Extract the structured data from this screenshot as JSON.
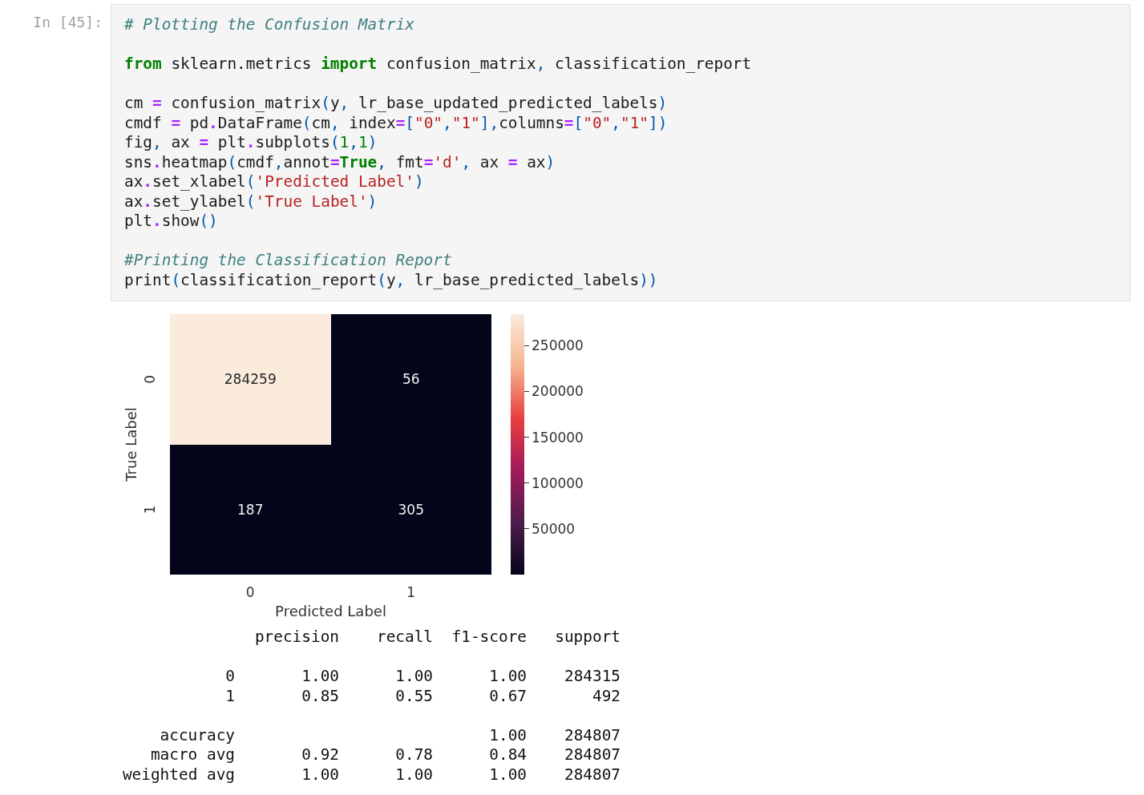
{
  "cell": {
    "prompt": "In [45]:",
    "code_blocks": [
      [
        [
          {
            "kind": "comment",
            "text": "# Plotting the Confusion Matrix"
          }
        ]
      ],
      [
        [
          {
            "kind": "keyword",
            "text": "from"
          },
          {
            "kind": "name",
            "text": " sklearn.metrics "
          },
          {
            "kind": "keyword",
            "text": "import"
          },
          {
            "kind": "name",
            "text": " confusion_matrix"
          },
          {
            "kind": "punct",
            "text": ","
          },
          {
            "kind": "name",
            "text": " classification_report"
          }
        ]
      ],
      [
        [
          {
            "kind": "name",
            "text": "cm "
          },
          {
            "kind": "operator",
            "text": "="
          },
          {
            "kind": "name",
            "text": " confusion_matrix"
          },
          {
            "kind": "punct",
            "text": "("
          },
          {
            "kind": "name",
            "text": "y"
          },
          {
            "kind": "punct",
            "text": ","
          },
          {
            "kind": "name",
            "text": " lr_base_updated_predicted_labels"
          },
          {
            "kind": "punct",
            "text": ")"
          }
        ],
        [
          {
            "kind": "name",
            "text": "cmdf "
          },
          {
            "kind": "operator",
            "text": "="
          },
          {
            "kind": "name",
            "text": " pd"
          },
          {
            "kind": "operator",
            "text": "."
          },
          {
            "kind": "name",
            "text": "DataFrame"
          },
          {
            "kind": "punct",
            "text": "("
          },
          {
            "kind": "name",
            "text": "cm"
          },
          {
            "kind": "punct",
            "text": ","
          },
          {
            "kind": "name",
            "text": " index"
          },
          {
            "kind": "operator",
            "text": "="
          },
          {
            "kind": "punct",
            "text": "["
          },
          {
            "kind": "string",
            "text": "\"0\""
          },
          {
            "kind": "punct",
            "text": ","
          },
          {
            "kind": "string",
            "text": "\"1\""
          },
          {
            "kind": "punct",
            "text": "],"
          },
          {
            "kind": "name",
            "text": "columns"
          },
          {
            "kind": "operator",
            "text": "="
          },
          {
            "kind": "punct",
            "text": "["
          },
          {
            "kind": "string",
            "text": "\"0\""
          },
          {
            "kind": "punct",
            "text": ","
          },
          {
            "kind": "string",
            "text": "\"1\""
          },
          {
            "kind": "punct",
            "text": "])"
          }
        ],
        [
          {
            "kind": "name",
            "text": "fig"
          },
          {
            "kind": "punct",
            "text": ","
          },
          {
            "kind": "name",
            "text": " ax "
          },
          {
            "kind": "operator",
            "text": "="
          },
          {
            "kind": "name",
            "text": " plt"
          },
          {
            "kind": "operator",
            "text": "."
          },
          {
            "kind": "name",
            "text": "subplots"
          },
          {
            "kind": "punct",
            "text": "("
          },
          {
            "kind": "number",
            "text": "1"
          },
          {
            "kind": "punct",
            "text": ","
          },
          {
            "kind": "number",
            "text": "1"
          },
          {
            "kind": "punct",
            "text": ")"
          }
        ],
        [
          {
            "kind": "name",
            "text": "sns"
          },
          {
            "kind": "operator",
            "text": "."
          },
          {
            "kind": "name",
            "text": "heatmap"
          },
          {
            "kind": "punct",
            "text": "("
          },
          {
            "kind": "name",
            "text": "cmdf"
          },
          {
            "kind": "punct",
            "text": ","
          },
          {
            "kind": "name",
            "text": "annot"
          },
          {
            "kind": "operator",
            "text": "="
          },
          {
            "kind": "keyword",
            "text": "True"
          },
          {
            "kind": "punct",
            "text": ","
          },
          {
            "kind": "name",
            "text": " fmt"
          },
          {
            "kind": "operator",
            "text": "="
          },
          {
            "kind": "string",
            "text": "'d'"
          },
          {
            "kind": "punct",
            "text": ","
          },
          {
            "kind": "name",
            "text": " ax "
          },
          {
            "kind": "operator",
            "text": "="
          },
          {
            "kind": "name",
            "text": " ax"
          },
          {
            "kind": "punct",
            "text": ")"
          }
        ],
        [
          {
            "kind": "name",
            "text": "ax"
          },
          {
            "kind": "operator",
            "text": "."
          },
          {
            "kind": "name",
            "text": "set_xlabel"
          },
          {
            "kind": "punct",
            "text": "("
          },
          {
            "kind": "string",
            "text": "'Predicted Label'"
          },
          {
            "kind": "punct",
            "text": ")"
          }
        ],
        [
          {
            "kind": "name",
            "text": "ax"
          },
          {
            "kind": "operator",
            "text": "."
          },
          {
            "kind": "name",
            "text": "set_ylabel"
          },
          {
            "kind": "punct",
            "text": "("
          },
          {
            "kind": "string",
            "text": "'True Label'"
          },
          {
            "kind": "punct",
            "text": ")"
          }
        ],
        [
          {
            "kind": "name",
            "text": "plt"
          },
          {
            "kind": "operator",
            "text": "."
          },
          {
            "kind": "name",
            "text": "show"
          },
          {
            "kind": "punct",
            "text": "()"
          }
        ]
      ],
      [
        [
          {
            "kind": "comment",
            "text": "#Printing the Classification Report"
          }
        ],
        [
          {
            "kind": "name",
            "text": "print"
          },
          {
            "kind": "punct",
            "text": "("
          },
          {
            "kind": "name",
            "text": "classification_report"
          },
          {
            "kind": "punct",
            "text": "("
          },
          {
            "kind": "name",
            "text": "y"
          },
          {
            "kind": "punct",
            "text": ","
          },
          {
            "kind": "name",
            "text": " lr_base_predicted_labels"
          },
          {
            "kind": "punct",
            "text": "))"
          }
        ]
      ]
    ]
  },
  "heatmap": {
    "xlabel": "Predicted Label",
    "ylabel": "True Label",
    "xticks": [
      "0",
      "1"
    ],
    "yticks": [
      "0",
      "1"
    ],
    "rows": [
      [
        {
          "value": "284259",
          "color": "#faebdd"
        },
        {
          "value": "56",
          "color": "#03051a"
        }
      ],
      [
        {
          "value": "187",
          "color": "#03051a"
        },
        {
          "value": "305",
          "color": "#03051a"
        }
      ]
    ],
    "colorbar_ticks": [
      "250000",
      "200000",
      "150000",
      "100000",
      "50000"
    ]
  },
  "report": {
    "columns": [
      "precision",
      "recall",
      "f1-score",
      "support"
    ],
    "groups": [
      [
        {
          "label": "0",
          "cells": [
            "1.00",
            "1.00",
            "1.00",
            "284315"
          ]
        },
        {
          "label": "1",
          "cells": [
            "0.85",
            "0.55",
            "0.67",
            "492"
          ]
        }
      ],
      [
        {
          "label": "accuracy",
          "cells": [
            null,
            null,
            "1.00",
            "284807"
          ]
        },
        {
          "label": "macro avg",
          "cells": [
            "0.92",
            "0.78",
            "0.84",
            "284807"
          ]
        },
        {
          "label": "weighted avg",
          "cells": [
            "1.00",
            "1.00",
            "1.00",
            "284807"
          ]
        }
      ]
    ]
  }
}
